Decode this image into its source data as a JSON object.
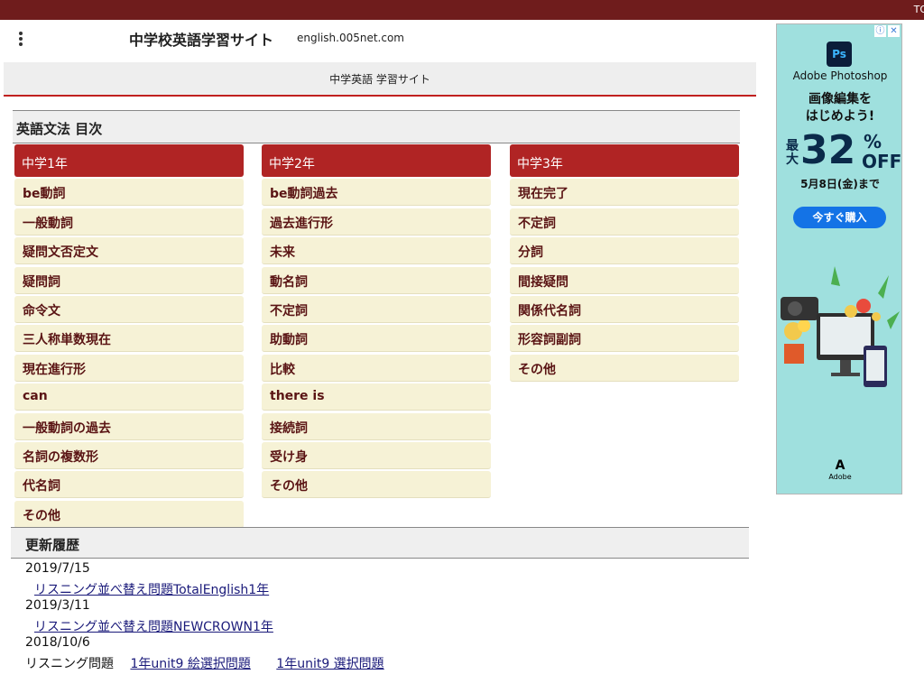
{
  "topbar": {
    "link_text": "TO"
  },
  "header": {
    "site_title": "中学校英語学習サイト",
    "site_url": "english.005net.com",
    "menu_icon": "more-vert-icon"
  },
  "subheader": {
    "text": "中学英語 学習サイト"
  },
  "grammar": {
    "heading": "英語文法 目次",
    "columns": [
      {
        "title": "中学1年",
        "items": [
          "be動詞",
          "一般動詞",
          "疑問文否定文",
          "疑問詞",
          "命令文",
          "三人称単数現在",
          "現在進行形",
          "can",
          "一般動詞の過去",
          "名詞の複数形",
          "代名詞",
          "その他"
        ]
      },
      {
        "title": "中学2年",
        "items": [
          "be動詞過去",
          "過去進行形",
          "未来",
          "動名詞",
          "不定詞",
          "助動詞",
          "比較",
          "there is",
          "接続詞",
          "受け身",
          "その他"
        ]
      },
      {
        "title": "中学3年",
        "items": [
          "現在完了",
          "不定詞",
          "分詞",
          "間接疑問",
          "関係代名詞",
          "形容詞副詞",
          "その他"
        ]
      }
    ]
  },
  "updates": {
    "heading": "更新履歴",
    "entries": [
      {
        "date": "2019/7/15",
        "link": "リスニング並べ替え問題TotalEnglish1年"
      },
      {
        "date": "2019/3/11",
        "link": "リスニング並べ替え問題NEWCROWN1年"
      },
      {
        "date": "2018/10/6",
        "label": "リスニング問題",
        "links": [
          "1年unit9 絵選択問題",
          "1年unit9 選択問題"
        ]
      }
    ]
  },
  "ad": {
    "info_icon": "info-icon",
    "close_icon": "close-icon",
    "logo_text": "Ps",
    "product": "Adobe Photoshop",
    "headline_1": "画像編集を",
    "headline_2": "はじめよう!",
    "discount_prefix": "最大",
    "discount_number": "32",
    "discount_percent": "%",
    "discount_off": "OFF",
    "date_text": "5月8日(金)まで",
    "cta": "今すぐ購入",
    "brand": "Adobe",
    "colors": {
      "background": "#9fe0de",
      "cta": "#1473e6"
    }
  },
  "colors": {
    "topbar": "#6f1c1c",
    "accent": "#b02424",
    "item_bg": "#f6f2d6",
    "item_text": "#5a1414"
  }
}
